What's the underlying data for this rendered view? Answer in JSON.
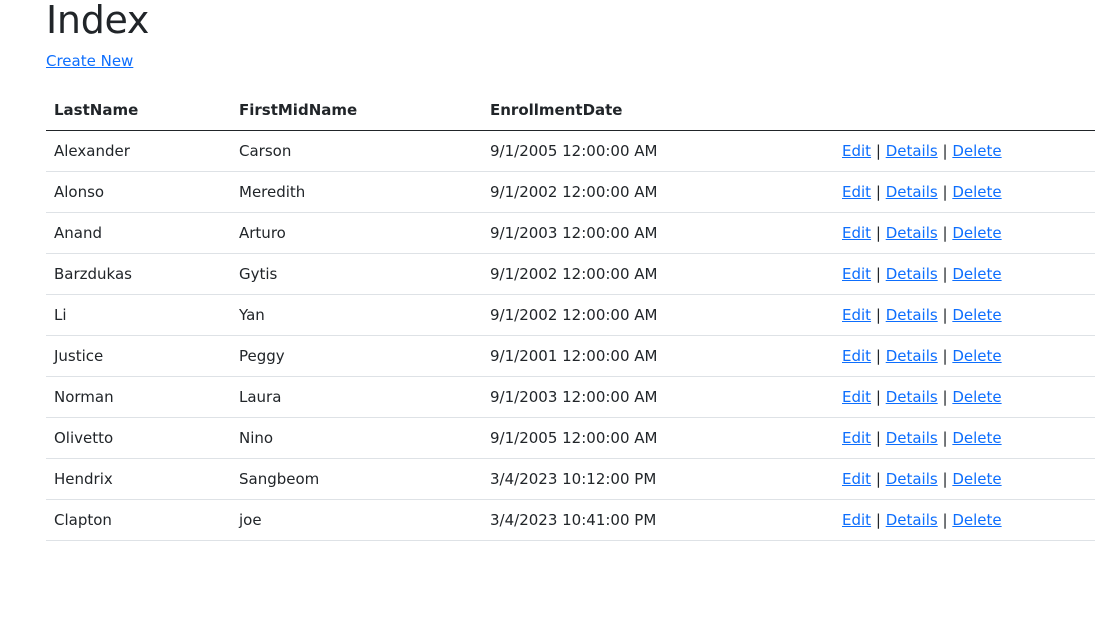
{
  "page": {
    "title": "Index",
    "create_link": "Create New"
  },
  "table": {
    "headers": [
      "LastName",
      "FirstMidName",
      "EnrollmentDate",
      ""
    ],
    "rows": [
      {
        "last": "Alexander",
        "first": "Carson",
        "date": "9/1/2005 12:00:00 AM"
      },
      {
        "last": "Alonso",
        "first": "Meredith",
        "date": "9/1/2002 12:00:00 AM"
      },
      {
        "last": "Anand",
        "first": "Arturo",
        "date": "9/1/2003 12:00:00 AM"
      },
      {
        "last": "Barzdukas",
        "first": "Gytis",
        "date": "9/1/2002 12:00:00 AM"
      },
      {
        "last": "Li",
        "first": "Yan",
        "date": "9/1/2002 12:00:00 AM"
      },
      {
        "last": "Justice",
        "first": "Peggy",
        "date": "9/1/2001 12:00:00 AM"
      },
      {
        "last": "Norman",
        "first": "Laura",
        "date": "9/1/2003 12:00:00 AM"
      },
      {
        "last": "Olivetto",
        "first": "Nino",
        "date": "9/1/2005 12:00:00 AM"
      },
      {
        "last": "Hendrix",
        "first": "Sangbeom",
        "date": "3/4/2023 10:12:00 PM"
      },
      {
        "last": "Clapton",
        "first": "joe",
        "date": "3/4/2023 10:41:00 PM"
      }
    ],
    "actions": {
      "edit": "Edit",
      "details": "Details",
      "delete": "Delete",
      "separator": "|"
    }
  },
  "colors": {
    "link": "#0d6efd",
    "text": "#212529",
    "row_border": "#dee2e6"
  }
}
